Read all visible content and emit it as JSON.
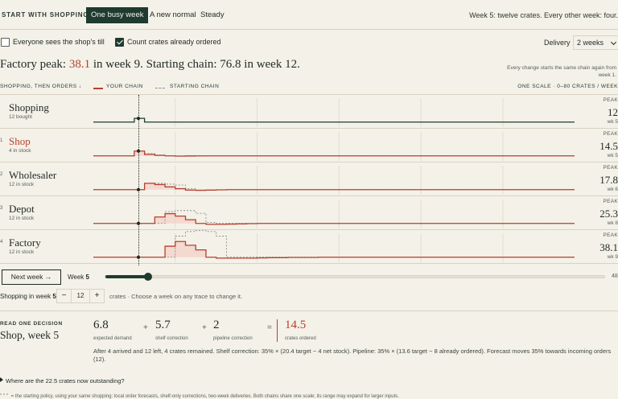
{
  "topbar": {
    "start_label": "START WITH SHOPPING",
    "scenarios": [
      "One busy week",
      "A new normal",
      "Steady"
    ],
    "active_scenario": "One busy week",
    "week_note": "Week 5: twelve crates. Every other week: four."
  },
  "options": {
    "everyone_sees_till": {
      "label": "Everyone sees the shop's till",
      "checked": false
    },
    "count_ordered": {
      "label": "Count crates already ordered",
      "checked": true
    },
    "delivery_label": "Delivery",
    "delivery_value": "2 weeks"
  },
  "headline": {
    "prefix": "Factory peak: ",
    "peak_value": "38.1",
    "middle": " in week 9. Starting chain: 76.8 in week 12."
  },
  "side_note": "Every change starts the same chain again from week 1.",
  "legend": {
    "order_label": "SHOPPING, THEN ORDERS ↓",
    "your_chain": "YOUR CHAIN",
    "starting_chain": "STARTING CHAIN",
    "scale_note": "ONE SCALE · 0–80 CRATES / WEEK"
  },
  "colors": {
    "your_chain": "#b5412f",
    "starting_chain": "#8a8f8a",
    "shopping_trace": "#1e3b30",
    "accent_dark": "#1e3b30"
  },
  "rows": [
    {
      "num": "",
      "name": "Shopping",
      "sub": "12 bought",
      "peak_label": "PEAK",
      "peak_value": "12",
      "peak_week": "wk 5",
      "highlight": false
    },
    {
      "num": "1",
      "name": "Shop",
      "sub": "4 in stock",
      "peak_label": "PEAK",
      "peak_value": "14.5",
      "peak_week": "wk 5",
      "highlight": true
    },
    {
      "num": "2",
      "name": "Wholesaler",
      "sub": "12 in stock",
      "peak_label": "PEAK",
      "peak_value": "17.8",
      "peak_week": "wk 6",
      "highlight": false
    },
    {
      "num": "3",
      "name": "Depot",
      "sub": "12 in stock",
      "peak_label": "PEAK",
      "peak_value": "25.3",
      "peak_week": "wk 8",
      "highlight": false
    },
    {
      "num": "4",
      "name": "Factory",
      "sub": "12 in stock",
      "peak_label": "PEAK",
      "peak_value": "38.1",
      "peak_week": "wk 9",
      "highlight": false
    }
  ],
  "controls": {
    "next_week": "Next week →",
    "week_label": "Week",
    "week_value": "5",
    "week_max": "48",
    "week_fraction": 0.085
  },
  "shopping": {
    "label_prefix": "Shopping in week ",
    "label_week": "5",
    "minus": "−",
    "value": "12",
    "plus": "+",
    "hint": "crates · Choose a week on any trace to change it."
  },
  "decision": {
    "kicker": "READ ONE DECISION",
    "title": "Shop, week 5",
    "terms": [
      {
        "value": "6.8",
        "label": "expected demand"
      },
      {
        "value": "5.7",
        "label": "shelf correction"
      },
      {
        "value": "2",
        "label": "pipeline correction"
      },
      {
        "value": "14.5",
        "label": "crates ordered"
      }
    ],
    "ops": [
      "+",
      "+",
      "="
    ],
    "explain": "After 4 arrived and 12 left, 4 crates remained. Shelf correction: 35% × (20.4 target − 4 net stock). Pipeline: 35% × (13.6 target − 8 already ordered). Forecast moves 35% towards incoming orders (12)."
  },
  "footer": {
    "outstanding": "Where are the 22.5 crates now outstanding?",
    "footnote": "= the starting policy, using your same shopping: local order forecasts, shelf-only corrections, two-week deliveries. Both chains share one scale; its range may expand for larger inputs."
  },
  "chart_data": {
    "type": "line",
    "ylim": [
      0,
      80
    ],
    "x": [
      1,
      2,
      3,
      4,
      5,
      6,
      7,
      8,
      9,
      10,
      11,
      12,
      13,
      14,
      15,
      16,
      17,
      18,
      19,
      20,
      21,
      22,
      23,
      24,
      25,
      26,
      27,
      28,
      29,
      30,
      31,
      32,
      33,
      34,
      35,
      36,
      37,
      38,
      39,
      40,
      41,
      42,
      43,
      44,
      45,
      46,
      47,
      48
    ],
    "panels": [
      {
        "name": "Shopping",
        "series": [
          {
            "name": "YOUR CHAIN",
            "values": [
              4,
              4,
              4,
              4,
              12,
              4,
              4,
              4,
              4,
              4,
              4,
              4,
              4,
              4,
              4,
              4,
              4,
              4,
              4,
              4,
              4,
              4,
              4,
              4,
              4,
              4,
              4,
              4,
              4,
              4,
              4,
              4,
              4,
              4,
              4,
              4,
              4,
              4,
              4,
              4,
              4,
              4,
              4,
              4,
              4,
              4,
              4,
              4
            ]
          }
        ]
      },
      {
        "name": "Shop",
        "series": [
          {
            "name": "YOUR CHAIN",
            "values": [
              4,
              4,
              4,
              4,
              14.5,
              7,
              5,
              4,
              3.5,
              3.8,
              4,
              4,
              4,
              4,
              4,
              4,
              4,
              4,
              4,
              4,
              4,
              4,
              4,
              4,
              4,
              4,
              4,
              4,
              4,
              4,
              4,
              4,
              4,
              4,
              4,
              4,
              4,
              4,
              4,
              4,
              4,
              4,
              4,
              4,
              4,
              4,
              4,
              4
            ]
          },
          {
            "name": "STARTING CHAIN",
            "values": [
              4,
              4,
              4,
              4,
              14,
              9,
              6,
              4,
              3,
              3,
              3.5,
              4,
              4,
              4,
              4,
              4,
              4,
              4,
              4,
              4,
              4,
              4,
              4,
              4,
              4,
              4,
              4,
              4,
              4,
              4,
              4,
              4,
              4,
              4,
              4,
              4,
              4,
              4,
              4,
              4,
              4,
              4,
              4,
              4,
              4,
              4,
              4,
              4
            ]
          }
        ]
      },
      {
        "name": "Wholesaler",
        "series": [
          {
            "name": "YOUR CHAIN",
            "values": [
              4,
              4,
              4,
              4,
              4,
              17.8,
              15,
              10,
              6,
              3,
              2.5,
              3,
              3.5,
              4,
              4,
              4,
              4,
              4,
              4,
              4,
              4,
              4,
              4,
              4,
              4,
              4,
              4,
              4,
              4,
              4,
              4,
              4,
              4,
              4,
              4,
              4,
              4,
              4,
              4,
              4,
              4,
              4,
              4,
              4,
              4,
              4,
              4,
              4
            ]
          },
          {
            "name": "STARTING CHAIN",
            "values": [
              4,
              4,
              4,
              4,
              4,
              18,
              18,
              16,
              14,
              6,
              3,
              3,
              3.5,
              4,
              4,
              4,
              4,
              4,
              4,
              4,
              4,
              4,
              4,
              4,
              4,
              4,
              4,
              4,
              4,
              4,
              4,
              4,
              4,
              4,
              4,
              4,
              4,
              4,
              4,
              4,
              4,
              4,
              4,
              4,
              4,
              4,
              4,
              4
            ]
          }
        ]
      },
      {
        "name": "Depot",
        "series": [
          {
            "name": "YOUR CHAIN",
            "values": [
              4,
              4,
              4,
              4,
              4,
              4,
              18,
              25.3,
              20,
              12,
              4,
              2,
              2,
              2.5,
              3,
              3.5,
              4,
              4,
              4,
              4,
              4,
              4,
              4,
              4,
              4,
              4,
              4,
              4,
              4,
              4,
              4,
              4,
              4,
              4,
              4,
              4,
              4,
              4,
              4,
              4,
              4,
              4,
              4,
              4,
              4,
              4,
              4,
              4
            ]
          },
          {
            "name": "STARTING CHAIN",
            "values": [
              4,
              4,
              4,
              4,
              4,
              4,
              4,
              30,
              32,
              32,
              26,
              6,
              4,
              4,
              4,
              4,
              4,
              4,
              4,
              4,
              4,
              4,
              4,
              4,
              4,
              4,
              4,
              4,
              4,
              4,
              4,
              4,
              4,
              4,
              4,
              4,
              4,
              4,
              4,
              4,
              4,
              4,
              4,
              4,
              4,
              4,
              4,
              4
            ]
          }
        ]
      },
      {
        "name": "Factory",
        "series": [
          {
            "name": "YOUR CHAIN",
            "values": [
              4,
              4,
              4,
              4,
              4,
              4,
              4,
              28,
              38.1,
              30,
              20,
              4,
              2,
              2,
              2,
              2,
              2.5,
              3,
              3,
              3.5,
              3.5,
              3.5,
              4,
              4,
              4,
              4,
              4,
              4,
              4,
              4,
              4,
              4,
              4,
              4,
              4,
              4,
              4,
              4,
              4,
              4,
              4,
              4,
              4,
              4,
              4,
              4,
              4,
              4
            ]
          },
          {
            "name": "STARTING CHAIN",
            "values": [
              4,
              4,
              4,
              4,
              4,
              4,
              4,
              4,
              50,
              60,
              62,
              60,
              50,
              4,
              4,
              4,
              4,
              4,
              4,
              4,
              4,
              4,
              4,
              4,
              4,
              4,
              4,
              4,
              4,
              4,
              4,
              4,
              4,
              4,
              4,
              4,
              4,
              4,
              4,
              4,
              4,
              4,
              4,
              4,
              4,
              4,
              4,
              4
            ]
          }
        ]
      }
    ]
  }
}
